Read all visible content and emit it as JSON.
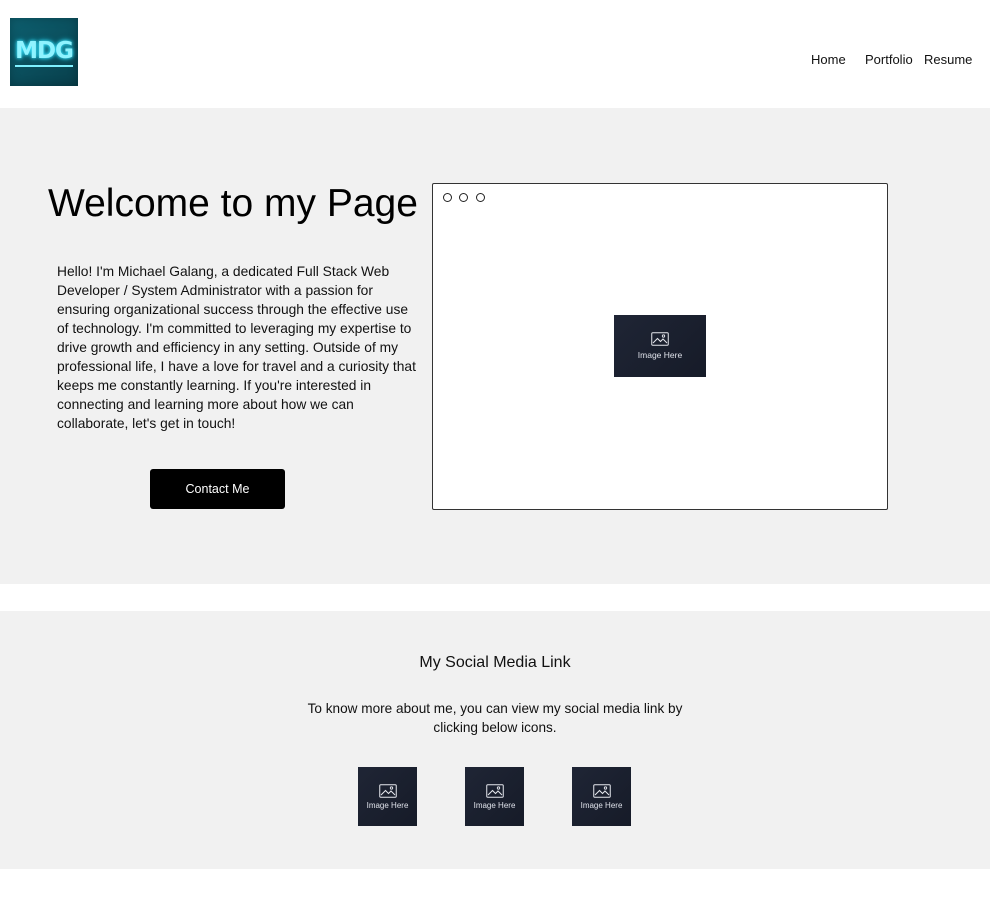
{
  "header": {
    "logo_text": "MDG",
    "nav": {
      "home": "Home",
      "portfolio": "Portfolio",
      "resume": "Resume"
    }
  },
  "hero": {
    "title": "Welcome to my Page",
    "intro": "Hello! I'm Michael Galang, a dedicated Full Stack Web Developer / System Administrator with a passion for ensuring organizational success through the effective use of technology. I'm committed to leveraging my expertise to drive growth and efficiency in any setting. Outside of my professional life, I have a love for travel and a curiosity that keeps me constantly learning. If you're interested in connecting and learning more about how we can collaborate, let's get in touch!",
    "contact_button": "Contact Me",
    "image_placeholder": "Image Here"
  },
  "social": {
    "title": "My Social Media Link",
    "description": "To know more about me, you can view my social media link  by clicking below icons.",
    "icons": [
      {
        "label": "Image Here"
      },
      {
        "label": "Image Here"
      },
      {
        "label": "Image Here"
      }
    ]
  },
  "colors": {
    "section_bg": "#f1f1f1",
    "button_bg": "#000000",
    "placeholder_bg": "#1c2232",
    "logo_bg": "#0b5463",
    "logo_glow": "#8ff3ff"
  },
  "icons": {
    "placeholder": "image-icon",
    "browser_dots": "window-control-dots"
  }
}
